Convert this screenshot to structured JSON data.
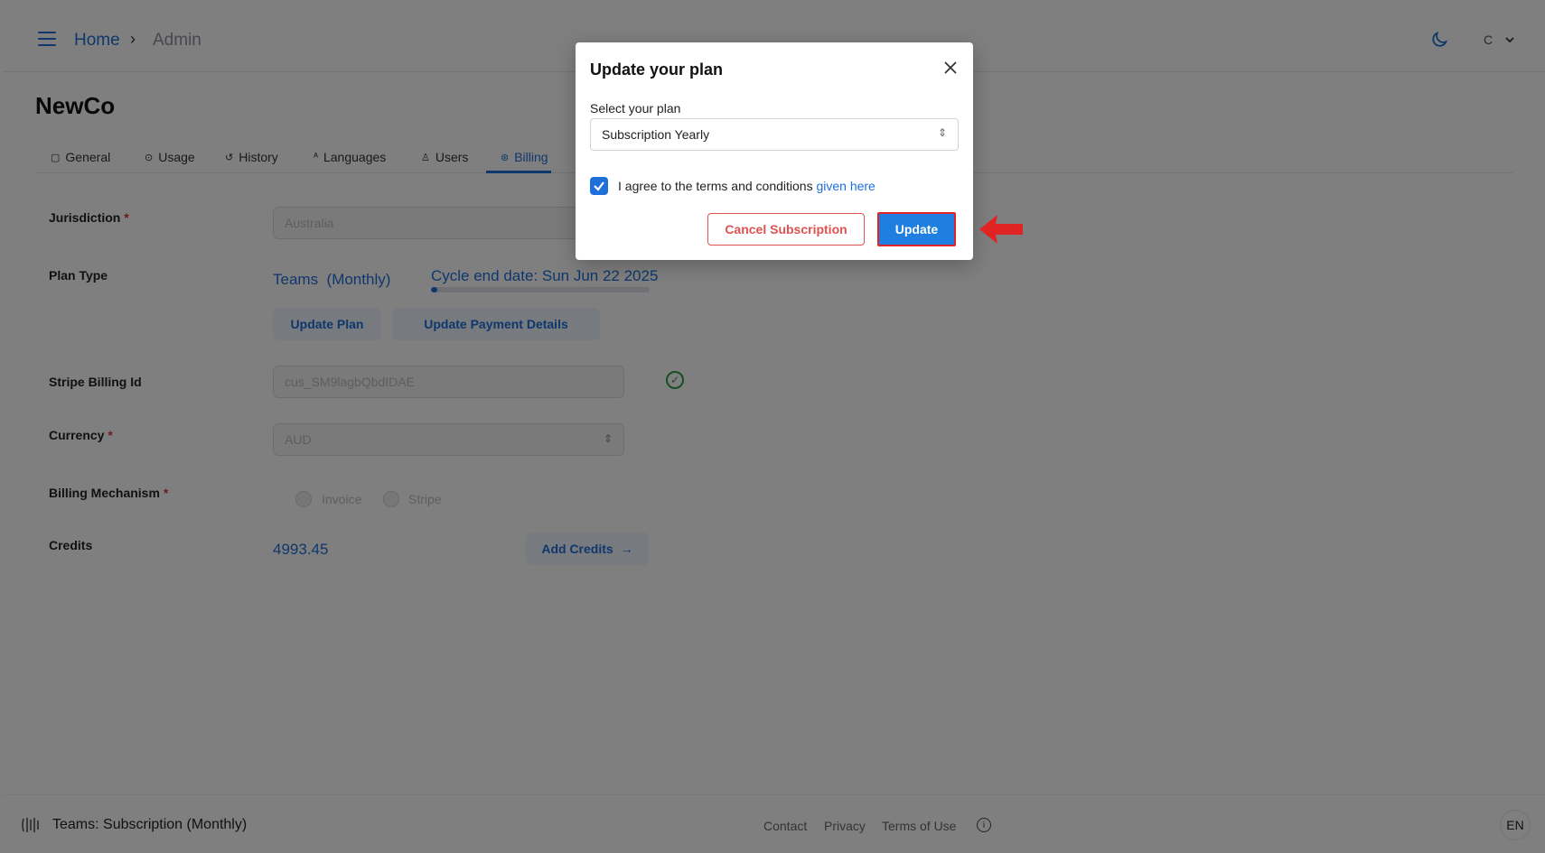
{
  "breadcrumb": {
    "home": "Home",
    "separator": "›",
    "current": "Admin"
  },
  "header": {
    "avatar_initial": "C"
  },
  "page": {
    "title": "NewCo"
  },
  "tabs": [
    {
      "label": "General",
      "icon": "general-icon"
    },
    {
      "label": "Usage",
      "icon": "usage-icon"
    },
    {
      "label": "History",
      "icon": "history-icon"
    },
    {
      "label": "Languages",
      "icon": "languages-icon"
    },
    {
      "label": "Users",
      "icon": "users-icon"
    },
    {
      "label": "Billing",
      "icon": "billing-icon",
      "active": true
    }
  ],
  "form": {
    "jurisdiction_label": "Jurisdiction",
    "jurisdiction_value": "Australia",
    "plan_type_label": "Plan Type",
    "plan_name": "Teams",
    "plan_period": "(Monthly)",
    "cycle_end": "Cycle end date: Sun Jun 22 2025",
    "cycle_progress": 0.03,
    "update_plan_btn": "Update Plan",
    "update_payment_btn": "Update Payment Details",
    "stripe_label": "Stripe Billing Id",
    "stripe_value": "cus_SM9lagbQbdIDAE",
    "currency_label": "Currency",
    "currency_value": "AUD",
    "billing_mech_label": "Billing Mechanism",
    "billing_options": [
      "Invoice",
      "Stripe"
    ],
    "credits_label": "Credits",
    "credits_value": "4993.45",
    "add_credits_btn": "Add Credits",
    "required_mark": "*"
  },
  "footer": {
    "plan": "Teams: Subscription (Monthly)",
    "links": [
      "Contact",
      "Privacy",
      "Terms of Use"
    ],
    "lang": "EN"
  },
  "modal": {
    "title": "Update your plan",
    "select_label": "Select your plan",
    "select_value": "Subscription Yearly",
    "agree_text": "I agree to the terms and conditions",
    "agree_link": "given here",
    "agree_checked": true,
    "cancel_btn": "Cancel Subscription",
    "update_btn": "Update"
  },
  "colors": {
    "accent": "#1e6fd9",
    "danger": "#e05252",
    "annotation": "#e02424"
  }
}
